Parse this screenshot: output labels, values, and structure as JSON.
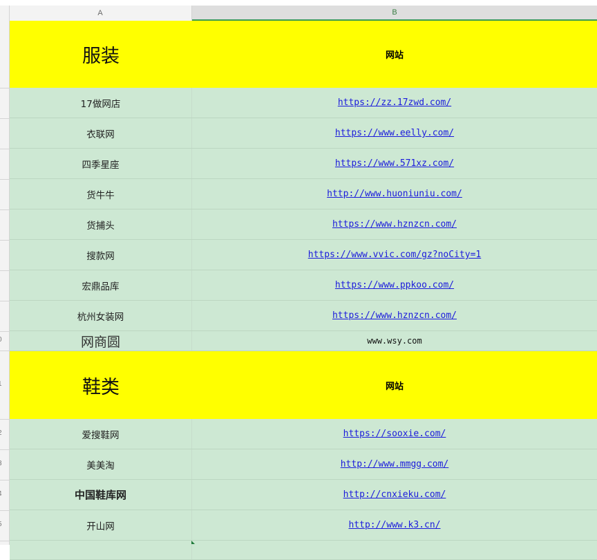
{
  "columns": {
    "a": "A",
    "b": "B"
  },
  "section1": {
    "title": "服装",
    "column_label": "网站",
    "rows": [
      {
        "name": "17做网店",
        "url": "https://zz.17zwd.com/"
      },
      {
        "name": "衣联网",
        "url": "https://www.eelly.com/"
      },
      {
        "name": "四季星座",
        "url": "https://www.571xz.com/"
      },
      {
        "name": "货牛牛",
        "url": "http://www.huoniuniu.com/"
      },
      {
        "name": "货捕头",
        "url": "https://www.hznzcn.com/"
      },
      {
        "name": "搜款网",
        "url": "https://www.vvic.com/gz?noCity=1"
      },
      {
        "name": "宏鼎品库",
        "url": "https://www.ppkoo.com/"
      },
      {
        "name": "杭州女装网",
        "url": "https://www.hznzcn.com/"
      },
      {
        "name": "网商圆",
        "url": "www.wsy.com"
      }
    ]
  },
  "section2": {
    "title": "鞋类",
    "column_label": "网站",
    "rows": [
      {
        "name": "爱搜鞋网",
        "url": "https://sooxie.com/"
      },
      {
        "name": "美美淘",
        "url": "http://www.mmgg.com/"
      },
      {
        "name": "中国鞋库网",
        "url": "http://cnxieku.com/"
      },
      {
        "name": "开山网",
        "url": "http://www.k3.cn/"
      }
    ]
  },
  "row_numbers": [
    "0",
    "1",
    "2",
    "3",
    "4",
    "5"
  ],
  "colors": {
    "header_fill": "#ffff00",
    "row_fill": "#cde8d3",
    "link": "#1a1adc"
  }
}
